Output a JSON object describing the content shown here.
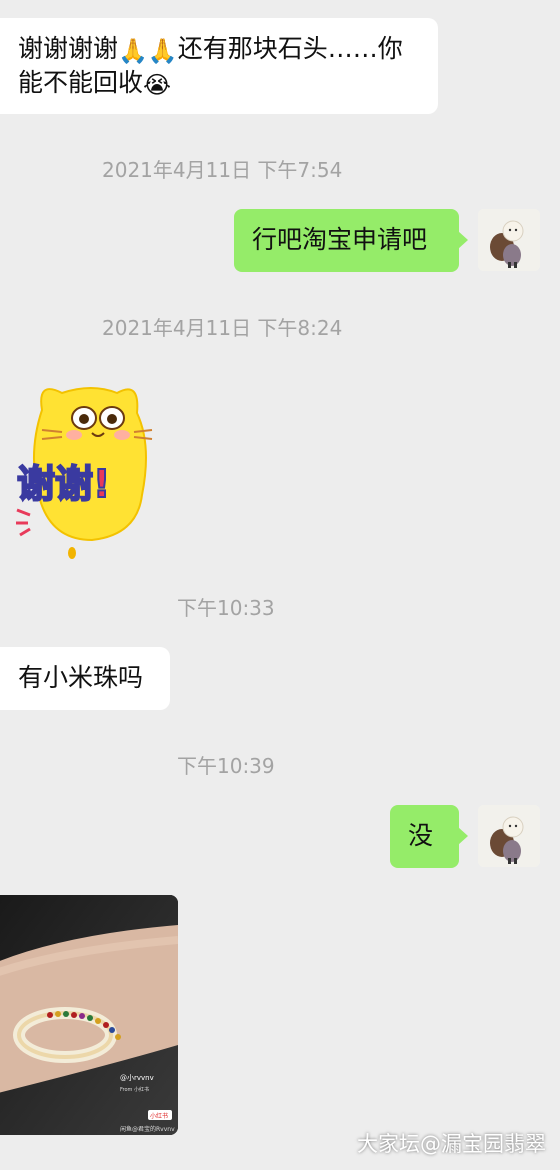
{
  "messages": {
    "m1": {
      "line1": "谢谢谢谢",
      "line1b": "还有那块石头……你",
      "line2": "能不能回收",
      "emoji_pray": "🙏",
      "emoji_cry": "😭"
    },
    "t1": "2021年4月11日 下午7:54",
    "m2": "行吧淘宝申请吧",
    "t2": "2021年4月11日 下午8:24",
    "sticker": {
      "text": "谢谢!"
    },
    "t3": "下午10:33",
    "m3": "有小米珠吗",
    "t4": "下午10:39",
    "m4": "没",
    "photo": {
      "caption_handle": "@小rvvnv",
      "caption_from": "From 小红书",
      "badge": "小红书",
      "bottom_text": "闲鱼@君宝的Rvvnv"
    }
  },
  "watermark": "大家坛@漏宝园翡翠",
  "colors": {
    "background": "#ededed",
    "sent_bubble": "#95ec69",
    "received_bubble": "#ffffff",
    "timestamp": "#a3a3a3"
  }
}
